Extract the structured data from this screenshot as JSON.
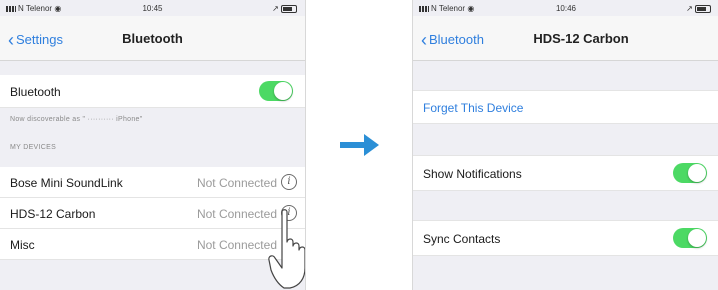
{
  "left": {
    "status": {
      "carrier": "N Telenor",
      "time": "10:45"
    },
    "nav": {
      "back": "Settings",
      "title": "Bluetooth"
    },
    "bluetooth": {
      "label": "Bluetooth",
      "on": true
    },
    "discoverable": "Now discoverable as \" ·········· iPhone\"",
    "section": "MY DEVICES",
    "devices": [
      {
        "name": "Bose Mini SoundLink",
        "status": "Not Connected"
      },
      {
        "name": "HDS-12 Carbon",
        "status": "Not Connected"
      },
      {
        "name": "Misc",
        "status": "Not Connected"
      }
    ]
  },
  "right": {
    "status": {
      "carrier": "N Telenor",
      "time": "10:46"
    },
    "nav": {
      "back": "Bluetooth",
      "title": "HDS-12 Carbon"
    },
    "forget": "Forget This Device",
    "notifications": {
      "label": "Show Notifications",
      "on": true
    },
    "contacts": {
      "label": "Sync Contacts",
      "on": true
    }
  },
  "colors": {
    "accent": "#2f7fde",
    "toggle_on": "#4cd964",
    "arrow": "#2b8fd6"
  }
}
